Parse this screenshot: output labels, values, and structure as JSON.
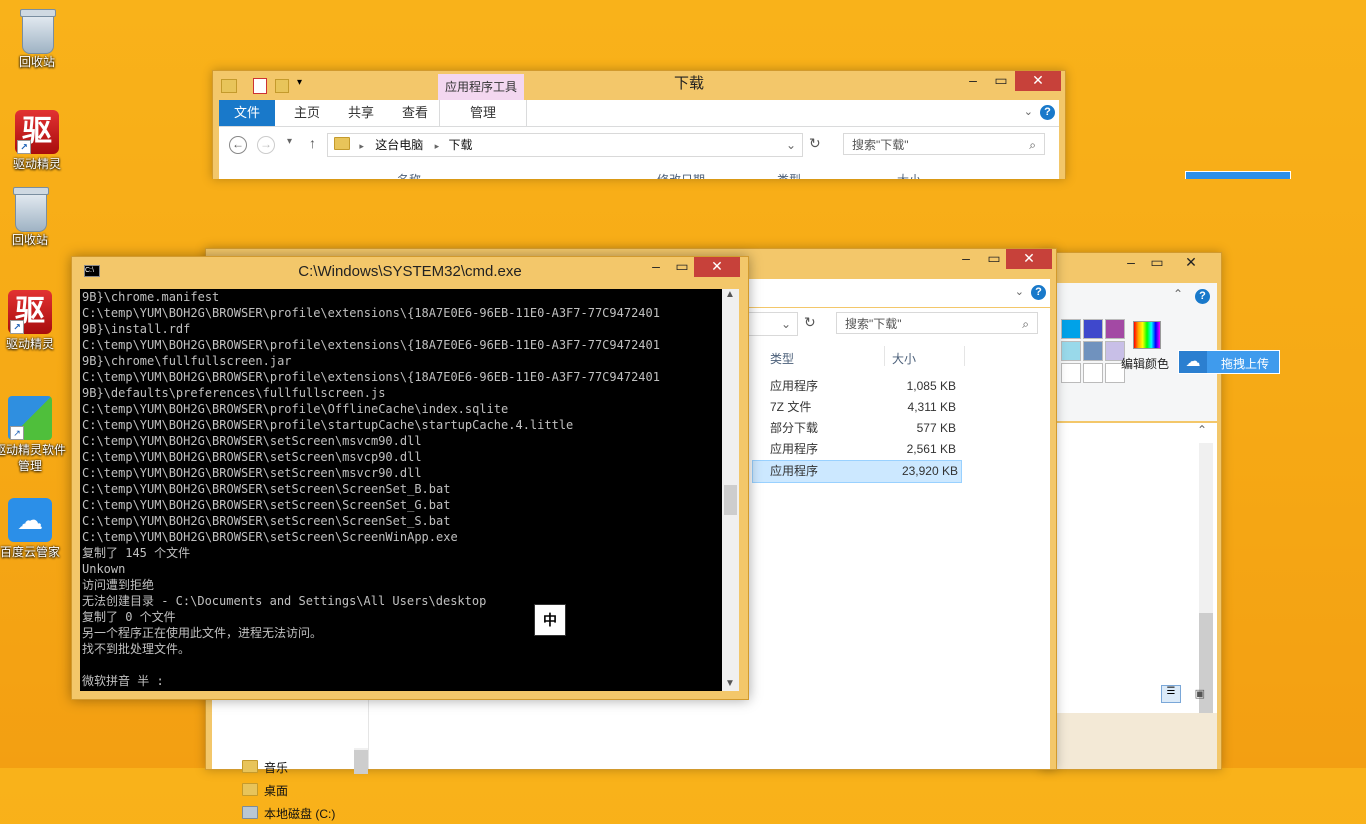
{
  "desktop": {
    "icons": [
      {
        "label": "回收站"
      },
      {
        "label": "驱动精灵"
      },
      {
        "label": "回收站"
      },
      {
        "label": "驱动精灵"
      },
      {
        "label": "驱动精灵软件管理"
      },
      {
        "label": "百度云管家"
      }
    ],
    "drv_glyph": "驱"
  },
  "explorer_top": {
    "title": "下载",
    "context_tab": "应用程序工具",
    "tabs": [
      "文件",
      "主页",
      "共享",
      "查看",
      "管理"
    ],
    "breadcrumb": [
      "这台电脑",
      "下载"
    ],
    "search_placeholder": "搜索\"下载\"",
    "columns": [
      "名称",
      "修改日期",
      "类型",
      "大小"
    ]
  },
  "explorer_back": {
    "search_placeholder": "搜索\"下载\"",
    "columns": [
      "类型",
      "大小"
    ],
    "rows": [
      {
        "type": "应用程序",
        "size": "1,085 KB"
      },
      {
        "type": "7Z 文件",
        "size": "4,311 KB"
      },
      {
        "type": "部分下载",
        "size": "577 KB"
      },
      {
        "type": "应用程序",
        "size": "2,561 KB"
      },
      {
        "type": "应用程序",
        "size": "23,920 KB",
        "selected": true
      }
    ],
    "nav": [
      "音乐",
      "桌面",
      "本地磁盘 (C:)"
    ]
  },
  "paint": {
    "edit_colors": "编辑颜色",
    "upload_button": "拖拽上传"
  },
  "cmd": {
    "title": "C:\\Windows\\SYSTEM32\\cmd.exe",
    "ime_char": "中",
    "lines": [
      "9B}\\chrome.manifest",
      "C:\\temp\\YUM\\BOH2G\\BROWSER\\profile\\extensions\\{18A7E0E6-96EB-11E0-A3F7-77C9472401",
      "9B}\\install.rdf",
      "C:\\temp\\YUM\\BOH2G\\BROWSER\\profile\\extensions\\{18A7E0E6-96EB-11E0-A3F7-77C9472401",
      "9B}\\chrome\\fullfullscreen.jar",
      "C:\\temp\\YUM\\BOH2G\\BROWSER\\profile\\extensions\\{18A7E0E6-96EB-11E0-A3F7-77C9472401",
      "9B}\\defaults\\preferences\\fullfullscreen.js",
      "C:\\temp\\YUM\\BOH2G\\BROWSER\\profile\\OfflineCache\\index.sqlite",
      "C:\\temp\\YUM\\BOH2G\\BROWSER\\profile\\startupCache\\startupCache.4.little",
      "C:\\temp\\YUM\\BOH2G\\BROWSER\\setScreen\\msvcm90.dll",
      "C:\\temp\\YUM\\BOH2G\\BROWSER\\setScreen\\msvcp90.dll",
      "C:\\temp\\YUM\\BOH2G\\BROWSER\\setScreen\\msvcr90.dll",
      "C:\\temp\\YUM\\BOH2G\\BROWSER\\setScreen\\ScreenSet_B.bat",
      "C:\\temp\\YUM\\BOH2G\\BROWSER\\setScreen\\ScreenSet_G.bat",
      "C:\\temp\\YUM\\BOH2G\\BROWSER\\setScreen\\ScreenSet_S.bat",
      "C:\\temp\\YUM\\BOH2G\\BROWSER\\setScreen\\ScreenWinApp.exe",
      "复制了 145 个文件",
      "Unkown",
      "访问遭到拒绝",
      "无法创建目录 - C:\\Documents and Settings\\All Users\\desktop",
      "复制了 0 个文件",
      "另一个程序正在使用此文件，进程无法访问。",
      "找不到批处理文件。",
      "",
      "微软拼音 半 :"
    ]
  }
}
